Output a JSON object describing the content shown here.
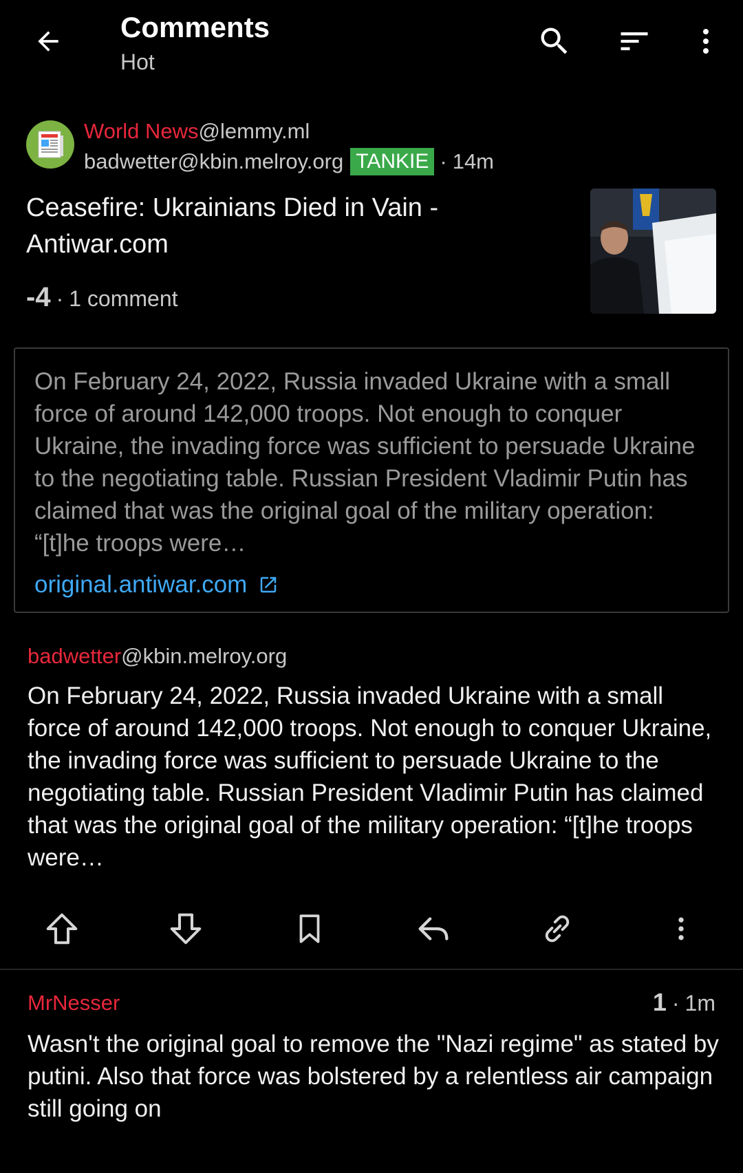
{
  "header": {
    "title": "Comments",
    "subtitle": "Hot",
    "icons": [
      "back-arrow-icon",
      "search-icon",
      "sort-icon",
      "more-vertical-icon"
    ]
  },
  "post": {
    "community": "World News",
    "community_instance": "@lemmy.ml",
    "author": "badwetter@kbin.melroy.org",
    "tag": "TANKIE",
    "separator": "·",
    "time": "14m",
    "title": "Ceasefire: Ukrainians Died in Vain - Antiwar.com",
    "score": "-4",
    "comment_count": "1 comment",
    "link_preview": {
      "excerpt": "On February 24, 2022, Russia invaded Ukraine with a small force of around 142,000 troops. Not enough to conquer Ukraine, the invading force was sufficient to persuade Ukraine to the negotiating table. Russian President Vladimir Putin has claimed that was the original goal of the military operation: “[t]he troops were…",
      "url": "original.antiwar.com"
    },
    "body_author_name": "badwetter",
    "body_author_instance": "@kbin.melroy.org",
    "body": "On February 24, 2022, Russia invaded Ukraine with a small force of around 142,000 troops. Not enough to conquer Ukraine, the invading force was sufficient to persuade Ukraine to the negotiating table. Russian President Vladimir Putin has claimed that was the original goal of the military operation: “[t]he troops were…",
    "actions": [
      "upvote-icon",
      "downvote-icon",
      "bookmark-icon",
      "reply-icon",
      "link-icon",
      "more-vertical-icon"
    ]
  },
  "comment": {
    "author": "MrNesser",
    "score": "1",
    "separator": "·",
    "time": "1m",
    "body": "Wasn't the original goal to remove the \"Nazi regime\" as stated by putini. Also that force was bolstered by a relentless air campaign still going on"
  },
  "colors": {
    "background": "#000000",
    "accent_red": "#e8273b",
    "tag_green": "#3aa94a",
    "link_blue": "#3fa9f5"
  }
}
